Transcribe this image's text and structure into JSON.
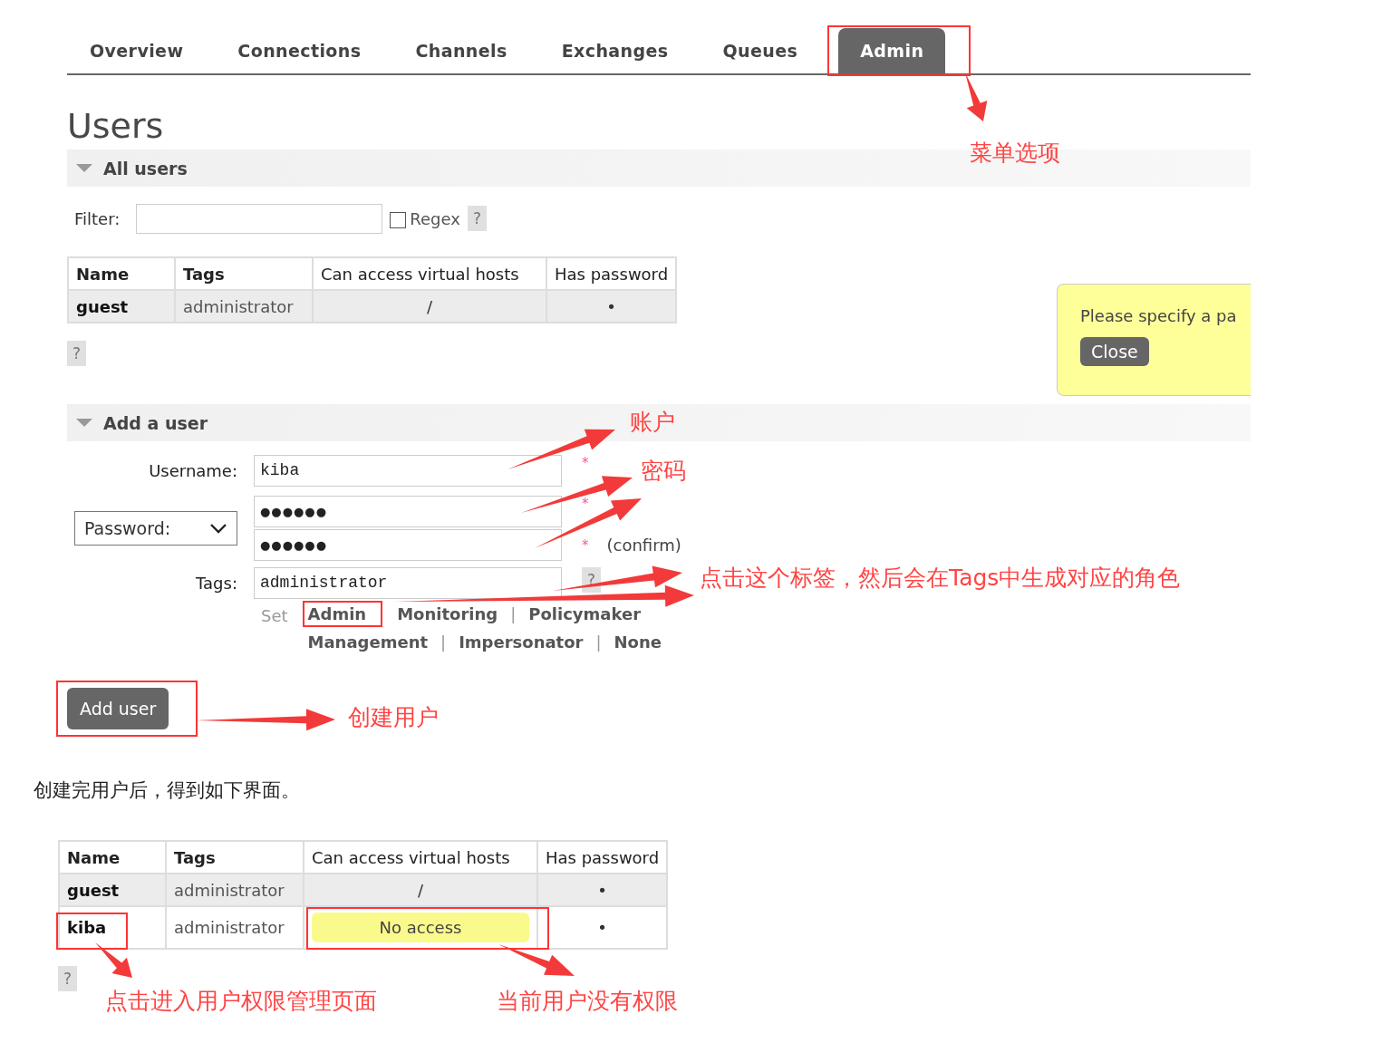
{
  "nav": {
    "tabs": [
      {
        "label": "Overview",
        "selected": false
      },
      {
        "label": "Connections",
        "selected": false
      },
      {
        "label": "Channels",
        "selected": false
      },
      {
        "label": "Exchanges",
        "selected": false
      },
      {
        "label": "Queues",
        "selected": false
      },
      {
        "label": "Admin",
        "selected": true
      }
    ]
  },
  "page_title": "Users",
  "all_users": {
    "heading": "All users",
    "filter": {
      "label": "Filter:"
    },
    "regex": {
      "label": "Regex",
      "checked": false
    },
    "filter_help": "?",
    "table": {
      "columns": [
        {
          "label": "Name",
          "sortable": true
        },
        {
          "label": "Tags",
          "sortable": true
        },
        {
          "label": "Can access virtual hosts",
          "sortable": false
        },
        {
          "label": "Has password",
          "sortable": false
        }
      ],
      "rows": [
        {
          "name": "guest",
          "tags": "administrator",
          "vhosts": "/",
          "access": true,
          "has_password": "•"
        }
      ]
    },
    "help": "?"
  },
  "notice": {
    "text": "Please specify a pa",
    "button": "Close"
  },
  "add_user": {
    "heading": "Add a user",
    "username": {
      "label": "Username:",
      "value": "kiba",
      "required": "*"
    },
    "password_mode": "Password:",
    "password": {
      "value": "●●●●●●",
      "required": "*"
    },
    "confirm": {
      "value": "●●●●●●",
      "required": "*",
      "note": "(confirm)"
    },
    "tags": {
      "label": "Tags:",
      "value": "administrator",
      "help": "?"
    },
    "set_label": "Set",
    "separator": "|",
    "tag_options": [
      "Admin",
      "Monitoring",
      "Policymaker",
      "Management",
      "Impersonator",
      "None"
    ],
    "submit": "Add user"
  },
  "article_text": "创建完用户后，得到如下界面。",
  "result": {
    "table": {
      "columns": [
        {
          "label": "Name",
          "sortable": true
        },
        {
          "label": "Tags",
          "sortable": true
        },
        {
          "label": "Can access virtual hosts",
          "sortable": false
        },
        {
          "label": "Has password",
          "sortable": false
        }
      ],
      "rows": [
        {
          "name": "guest",
          "tags": "administrator",
          "vhosts": "/",
          "access": true,
          "has_password": "•"
        },
        {
          "name": "kiba",
          "tags": "administrator",
          "vhosts": "No access",
          "access": false,
          "has_password": "•"
        }
      ]
    },
    "help": "?"
  },
  "annotations": [
    "菜单选项",
    "账户",
    "密码",
    "点击这个标签，然后会在Tags中生成对应的角色",
    "创建用户",
    "点击进入用户权限管理页面",
    "当前用户没有权限"
  ]
}
